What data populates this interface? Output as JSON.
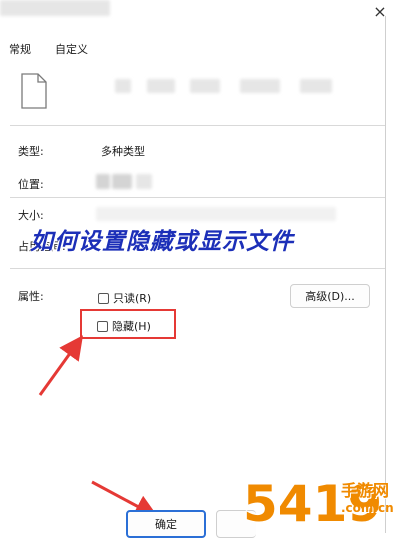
{
  "window": {
    "close_glyph": "×"
  },
  "tabs": [
    {
      "label": "常规"
    },
    {
      "label": "自定义"
    }
  ],
  "file_icon": "file-icon",
  "fields": {
    "type_label": "类型:",
    "type_value": "多种类型",
    "location_label": "位置:",
    "size_label": "大小:",
    "ondisk_label": "占用空间:"
  },
  "attributes": {
    "label": "属性:",
    "readonly_label": "只读(R)",
    "hidden_label": "隐藏(H)",
    "advanced_button": "高级(D)..."
  },
  "buttons": {
    "ok": "确定"
  },
  "overlay": {
    "headline": "如何设置隐藏或显示文件"
  },
  "watermark": {
    "logo_text": "5419",
    "site_name": "手游网",
    "site_url": ".com.cn"
  },
  "colors": {
    "annotation_red": "#e53935",
    "headline_blue": "#1c2fb8",
    "watermark_orange": "#f08a00"
  }
}
